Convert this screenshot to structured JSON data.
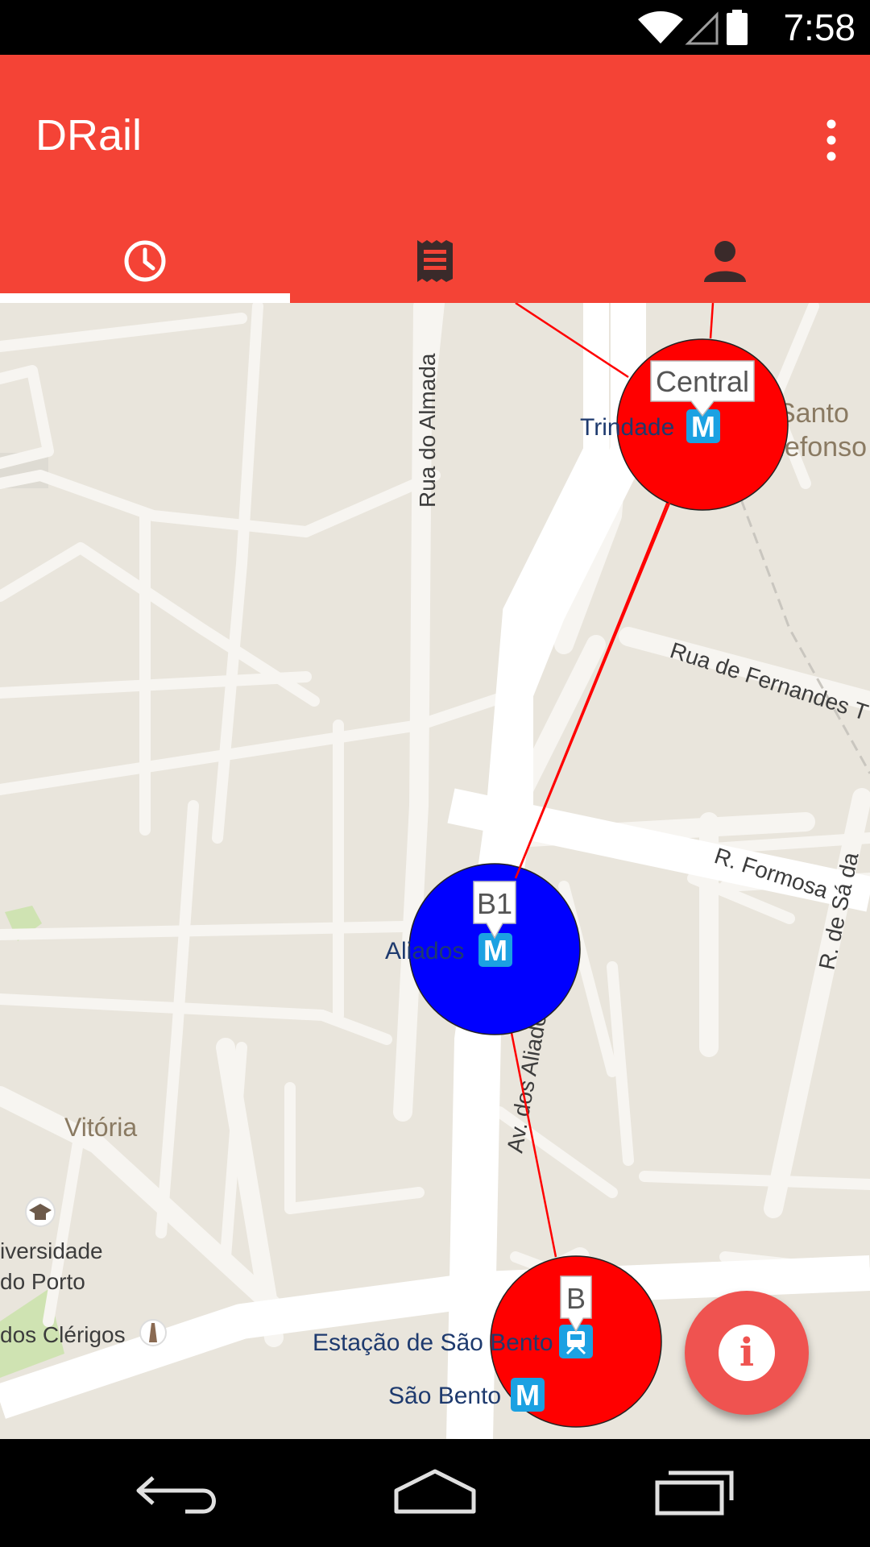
{
  "status": {
    "time": "7:58"
  },
  "app": {
    "title": "DRail"
  },
  "tabs": [
    {
      "icon": "clock-icon",
      "selected": true
    },
    {
      "icon": "ticket-icon",
      "selected": false
    },
    {
      "icon": "person-icon",
      "selected": false
    }
  ],
  "map": {
    "streets": {
      "almada": "Rua do Almada",
      "fernandes": "Rua de Fernandes T",
      "formosa": "R. Formosa",
      "sa": "R. de Sá da",
      "aliados": "Av. dos Aliados"
    },
    "places": {
      "santo": "Santo",
      "ildefonso": "Ildefonso",
      "vitoria": "Vitória",
      "universidade": "iversidade",
      "do_porto": "do Porto",
      "clerigos": "dos Clérigos"
    },
    "stations": {
      "trindade": "Trindade",
      "aliados": "Aliados",
      "sao_bento_train": "Estação de São Bento",
      "sao_bento_metro": "São Bento",
      "metro_glyph": "M"
    },
    "markers": [
      {
        "label": "Central",
        "color": "#ff0000"
      },
      {
        "label": "B1",
        "color": "#0000ff"
      },
      {
        "label": "B",
        "color": "#ff0000"
      }
    ],
    "route_color": "#ff0000"
  },
  "fab": {
    "glyph": "i",
    "color": "#ef5350"
  },
  "colors": {
    "accent": "#f44336"
  }
}
